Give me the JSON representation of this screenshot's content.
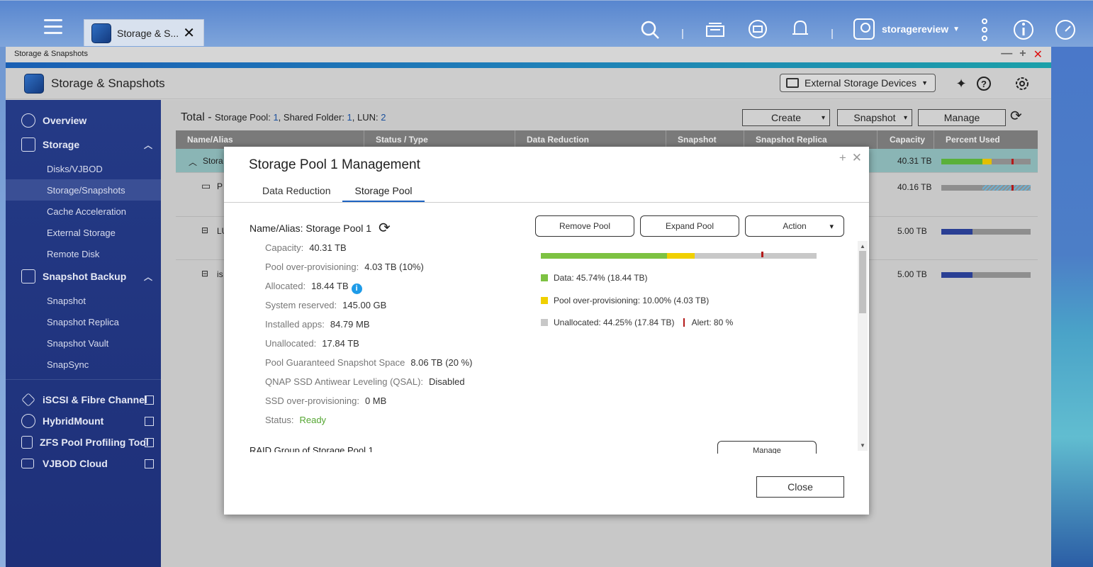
{
  "taskbar": {
    "tab_title": "Storage & S...",
    "username": "storagereview"
  },
  "window": {
    "title": "Storage & Snapshots",
    "app_title": "Storage & Snapshots",
    "external_storage_label": "External Storage Devices"
  },
  "sidebar": {
    "overview": "Overview",
    "storage": "Storage",
    "storage_items": [
      "Disks/VJBOD",
      "Storage/Snapshots",
      "Cache Acceleration",
      "External Storage",
      "Remote Disk"
    ],
    "snapshot_backup": "Snapshot Backup",
    "snapshot_items": [
      "Snapshot",
      "Snapshot Replica",
      "Snapshot Vault",
      "SnapSync"
    ],
    "external_links": [
      "iSCSI & Fibre Channel",
      "HybridMount",
      "ZFS Pool Profiling Tool",
      "VJBOD Cloud"
    ]
  },
  "main": {
    "total_label": "Total -",
    "storage_pool_label": "Storage Pool:",
    "storage_pool_count": "1",
    "shared_folder_label": "Shared Folder:",
    "shared_folder_count": "1",
    "lun_label": "LUN:",
    "lun_count": "2",
    "buttons": {
      "create": "Create",
      "snapshot": "Snapshot",
      "manage": "Manage"
    },
    "columns": [
      "Name/Alias",
      "Status / Type",
      "Data Reduction",
      "Snapshot",
      "Snapshot Replica",
      "Capacity",
      "Percent Used"
    ],
    "rows": [
      {
        "name": "Stora",
        "capacity": "40.31 TB"
      },
      {
        "name": "P",
        "capacity": "40.16 TB"
      },
      {
        "name": "LU",
        "capacity": "5.00 TB"
      },
      {
        "name": "is",
        "capacity": "5.00 TB"
      }
    ]
  },
  "modal": {
    "title": "Storage Pool 1 Management",
    "tabs": [
      "Data Reduction",
      "Storage Pool"
    ],
    "name_alias": "Name/Alias: Storage Pool 1",
    "buttons": {
      "remove": "Remove Pool",
      "expand": "Expand Pool",
      "action": "Action",
      "close": "Close",
      "raid_manage": "Manage"
    },
    "properties": [
      {
        "label": "Capacity:",
        "value": "40.31 TB"
      },
      {
        "label": "Pool over-provisioning:",
        "value": "4.03 TB (10%)"
      },
      {
        "label": "Allocated:",
        "value": "18.44 TB"
      },
      {
        "label": "System reserved:",
        "value": "145.00 GB"
      },
      {
        "label": "Installed apps:",
        "value": "84.79 MB"
      },
      {
        "label": "Unallocated:",
        "value": "17.84 TB"
      },
      {
        "label": "Pool Guaranteed Snapshot Space",
        "value": "8.06 TB (20 %)"
      },
      {
        "label": "QNAP SSD Antiwear Leveling (QSAL):",
        "value": "Disabled"
      },
      {
        "label": "SSD over-provisioning:",
        "value": "0 MB"
      },
      {
        "label": "Status:",
        "value": "Ready"
      }
    ],
    "usage": {
      "data_pct": 45.74,
      "overprov_pct": 10.0,
      "unalloc_pct": 44.25,
      "alert_pct": 80,
      "colors": {
        "data": "#7dc242",
        "overprov": "#f0d000",
        "unalloc": "#c8c8c8",
        "alert": "#b41a1a"
      }
    },
    "legend": {
      "data": "Data: 45.74% (18.44 TB)",
      "overprov": "Pool over-provisioning: 10.00% (4.03 TB)",
      "unalloc": "Unallocated: 44.25% (17.84 TB)",
      "alert": "Alert: 80 %"
    },
    "raid_title": "RAID Group of Storage Pool 1"
  }
}
